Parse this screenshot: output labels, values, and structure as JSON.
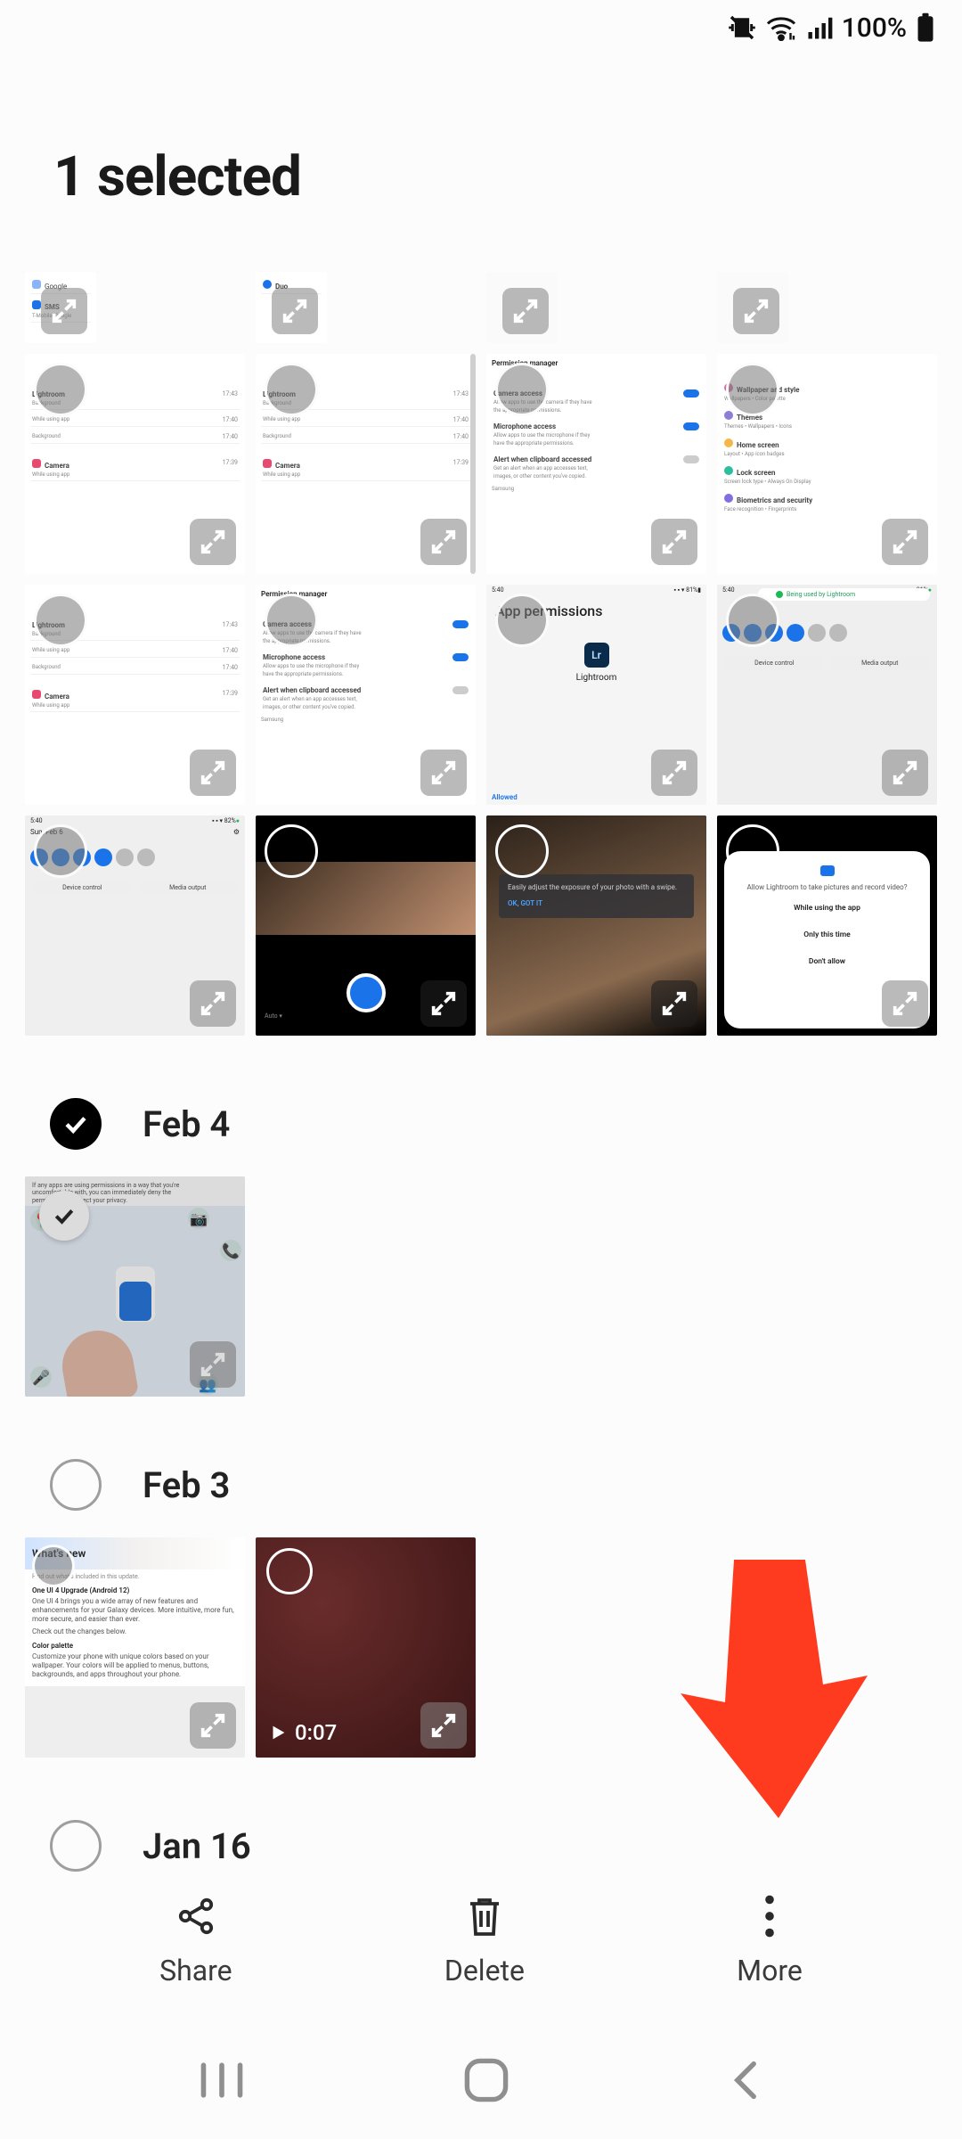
{
  "statusbar": {
    "battery": "100%"
  },
  "header": {
    "title": "1 selected"
  },
  "thumbnails": {
    "row1": {
      "a": {
        "lines": [
          [
            "SMS",
            "T-Mobile, Google"
          ]
        ],
        "duo": "Duo"
      }
    },
    "tile_lr_bg": {
      "e1_name": "Lightroom",
      "e1_sub": "Background",
      "e1_t": "17:43",
      "e2_name": "While using app",
      "e2_t": "17:40",
      "e3_name": "Background",
      "e3_t": "17:40",
      "cam_name": "Camera",
      "cam_sub": "While using app",
      "cam_t": "17:39"
    },
    "perm_mgr": {
      "title": "Permission manager",
      "p1": "—",
      "cam_h": "Camera access",
      "cam_d": "Allow apps to use the camera if they have the appropriate permissions.",
      "mic_h": "Microphone access",
      "mic_d": "Allow apps to use the microphone if they have the appropriate permissions.",
      "clip_h": "Alert when clipboard accessed",
      "clip_d": "Get an alert when an app accesses text, images, or other content you've copied.",
      "sam": "Samsung"
    },
    "settings_right": {
      "r1_h": "Wallpaper and style",
      "r1_d": "Wallpapers • Color palette",
      "r2_h": "Themes",
      "r2_d": "Themes • Wallpapers • Icons",
      "r3_h": "Home screen",
      "r3_d": "Layout • App icon badges",
      "r4_h": "Lock screen",
      "r4_d": "Screen lock type • Always On Display",
      "r5_h": "Biometrics and security",
      "r5_d": "Face recognition • Fingerprints"
    },
    "app_perm": {
      "title": "App permissions",
      "app": "Lightroom",
      "allowed": "Allowed"
    },
    "qs": {
      "time": "5:40",
      "date": "Sun, Feb 6",
      "pills": [
        "Device control",
        "Media output"
      ],
      "capsule": "Being used by Lightroom"
    },
    "cam_tip": {
      "msg": "Easily adjust the exposure of your photo with a swipe.",
      "ok": "OK, GOT IT"
    },
    "dialog": {
      "msg": "Allow Lightroom to take pictures and record video?",
      "o1": "While using the app",
      "o2": "Only this time",
      "o3": "Don't allow"
    },
    "feb4_tile": {
      "l1": "If any apps are using permissions in a way that you're",
      "l2": "uncomfortable with, you can immediately deny the",
      "l3": "permission to protect your privacy."
    },
    "feb3_wn": {
      "band": "What's new",
      "sub": "Find out what's included in this update.",
      "h1": "One UI 4 Upgrade (Android 12)",
      "p1": "One UI 4 brings you a wide array of new features and enhancements for your Galaxy devices. More intuitive, more fun, more secure, and easier than ever.",
      "p2": "Check out the changes below.",
      "h2": "Color palette",
      "p3": "Customize your phone with unique colors based on your wallpaper. Your colors will be applied to menus, buttons, backgrounds, and apps throughout your phone."
    },
    "video": {
      "duration": "0:07"
    }
  },
  "dates": {
    "feb4": "Feb 4",
    "feb3": "Feb 3",
    "jan16": "Jan 16"
  },
  "actions": {
    "share": "Share",
    "delete": "Delete",
    "more": "More"
  }
}
